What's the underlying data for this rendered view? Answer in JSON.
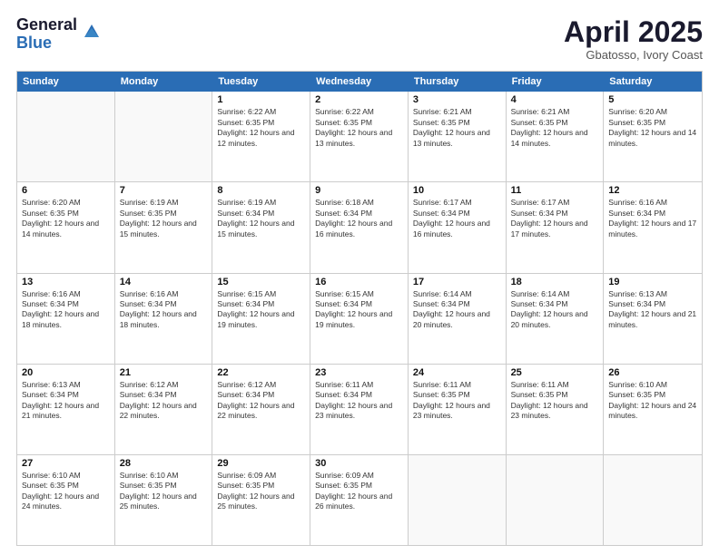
{
  "logo": {
    "general": "General",
    "blue": "Blue"
  },
  "header": {
    "title": "April 2025",
    "subtitle": "Gbatosso, Ivory Coast"
  },
  "calendar": {
    "days": [
      "Sunday",
      "Monday",
      "Tuesday",
      "Wednesday",
      "Thursday",
      "Friday",
      "Saturday"
    ],
    "rows": [
      [
        {
          "day": "",
          "text": ""
        },
        {
          "day": "",
          "text": ""
        },
        {
          "day": "1",
          "text": "Sunrise: 6:22 AM\nSunset: 6:35 PM\nDaylight: 12 hours and 12 minutes."
        },
        {
          "day": "2",
          "text": "Sunrise: 6:22 AM\nSunset: 6:35 PM\nDaylight: 12 hours and 13 minutes."
        },
        {
          "day": "3",
          "text": "Sunrise: 6:21 AM\nSunset: 6:35 PM\nDaylight: 12 hours and 13 minutes."
        },
        {
          "day": "4",
          "text": "Sunrise: 6:21 AM\nSunset: 6:35 PM\nDaylight: 12 hours and 14 minutes."
        },
        {
          "day": "5",
          "text": "Sunrise: 6:20 AM\nSunset: 6:35 PM\nDaylight: 12 hours and 14 minutes."
        }
      ],
      [
        {
          "day": "6",
          "text": "Sunrise: 6:20 AM\nSunset: 6:35 PM\nDaylight: 12 hours and 14 minutes."
        },
        {
          "day": "7",
          "text": "Sunrise: 6:19 AM\nSunset: 6:35 PM\nDaylight: 12 hours and 15 minutes."
        },
        {
          "day": "8",
          "text": "Sunrise: 6:19 AM\nSunset: 6:34 PM\nDaylight: 12 hours and 15 minutes."
        },
        {
          "day": "9",
          "text": "Sunrise: 6:18 AM\nSunset: 6:34 PM\nDaylight: 12 hours and 16 minutes."
        },
        {
          "day": "10",
          "text": "Sunrise: 6:17 AM\nSunset: 6:34 PM\nDaylight: 12 hours and 16 minutes."
        },
        {
          "day": "11",
          "text": "Sunrise: 6:17 AM\nSunset: 6:34 PM\nDaylight: 12 hours and 17 minutes."
        },
        {
          "day": "12",
          "text": "Sunrise: 6:16 AM\nSunset: 6:34 PM\nDaylight: 12 hours and 17 minutes."
        }
      ],
      [
        {
          "day": "13",
          "text": "Sunrise: 6:16 AM\nSunset: 6:34 PM\nDaylight: 12 hours and 18 minutes."
        },
        {
          "day": "14",
          "text": "Sunrise: 6:16 AM\nSunset: 6:34 PM\nDaylight: 12 hours and 18 minutes."
        },
        {
          "day": "15",
          "text": "Sunrise: 6:15 AM\nSunset: 6:34 PM\nDaylight: 12 hours and 19 minutes."
        },
        {
          "day": "16",
          "text": "Sunrise: 6:15 AM\nSunset: 6:34 PM\nDaylight: 12 hours and 19 minutes."
        },
        {
          "day": "17",
          "text": "Sunrise: 6:14 AM\nSunset: 6:34 PM\nDaylight: 12 hours and 20 minutes."
        },
        {
          "day": "18",
          "text": "Sunrise: 6:14 AM\nSunset: 6:34 PM\nDaylight: 12 hours and 20 minutes."
        },
        {
          "day": "19",
          "text": "Sunrise: 6:13 AM\nSunset: 6:34 PM\nDaylight: 12 hours and 21 minutes."
        }
      ],
      [
        {
          "day": "20",
          "text": "Sunrise: 6:13 AM\nSunset: 6:34 PM\nDaylight: 12 hours and 21 minutes."
        },
        {
          "day": "21",
          "text": "Sunrise: 6:12 AM\nSunset: 6:34 PM\nDaylight: 12 hours and 22 minutes."
        },
        {
          "day": "22",
          "text": "Sunrise: 6:12 AM\nSunset: 6:34 PM\nDaylight: 12 hours and 22 minutes."
        },
        {
          "day": "23",
          "text": "Sunrise: 6:11 AM\nSunset: 6:34 PM\nDaylight: 12 hours and 23 minutes."
        },
        {
          "day": "24",
          "text": "Sunrise: 6:11 AM\nSunset: 6:35 PM\nDaylight: 12 hours and 23 minutes."
        },
        {
          "day": "25",
          "text": "Sunrise: 6:11 AM\nSunset: 6:35 PM\nDaylight: 12 hours and 23 minutes."
        },
        {
          "day": "26",
          "text": "Sunrise: 6:10 AM\nSunset: 6:35 PM\nDaylight: 12 hours and 24 minutes."
        }
      ],
      [
        {
          "day": "27",
          "text": "Sunrise: 6:10 AM\nSunset: 6:35 PM\nDaylight: 12 hours and 24 minutes."
        },
        {
          "day": "28",
          "text": "Sunrise: 6:10 AM\nSunset: 6:35 PM\nDaylight: 12 hours and 25 minutes."
        },
        {
          "day": "29",
          "text": "Sunrise: 6:09 AM\nSunset: 6:35 PM\nDaylight: 12 hours and 25 minutes."
        },
        {
          "day": "30",
          "text": "Sunrise: 6:09 AM\nSunset: 6:35 PM\nDaylight: 12 hours and 26 minutes."
        },
        {
          "day": "",
          "text": ""
        },
        {
          "day": "",
          "text": ""
        },
        {
          "day": "",
          "text": ""
        }
      ]
    ]
  }
}
